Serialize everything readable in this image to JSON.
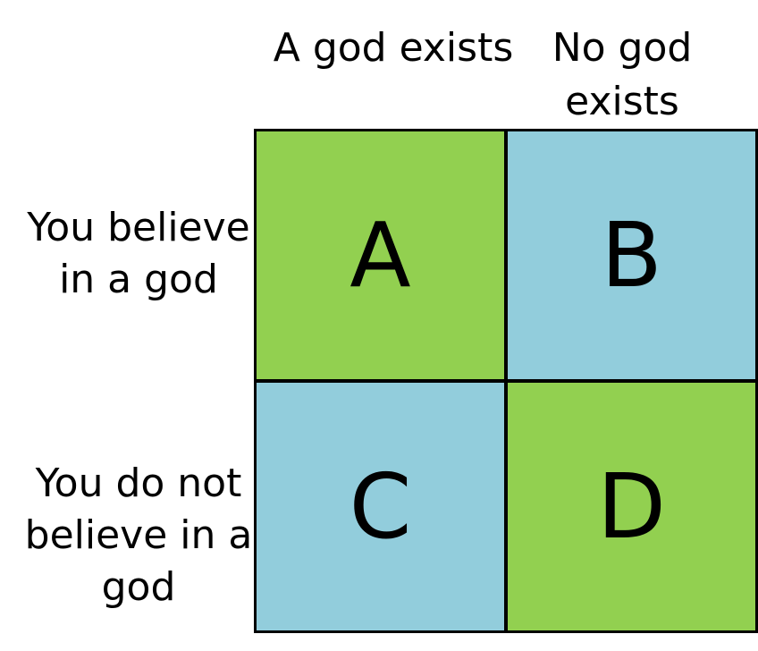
{
  "columns": [
    {
      "label": "A god exists"
    },
    {
      "label": "No god exists"
    }
  ],
  "rows": [
    {
      "label": "You believe in a god"
    },
    {
      "label": "You do not believe in a god"
    }
  ],
  "cells": [
    {
      "letter": "A",
      "color": "#92d050"
    },
    {
      "letter": "B",
      "color": "#92cddc"
    },
    {
      "letter": "C",
      "color": "#92cddc"
    },
    {
      "letter": "D",
      "color": "#92d050"
    }
  ]
}
